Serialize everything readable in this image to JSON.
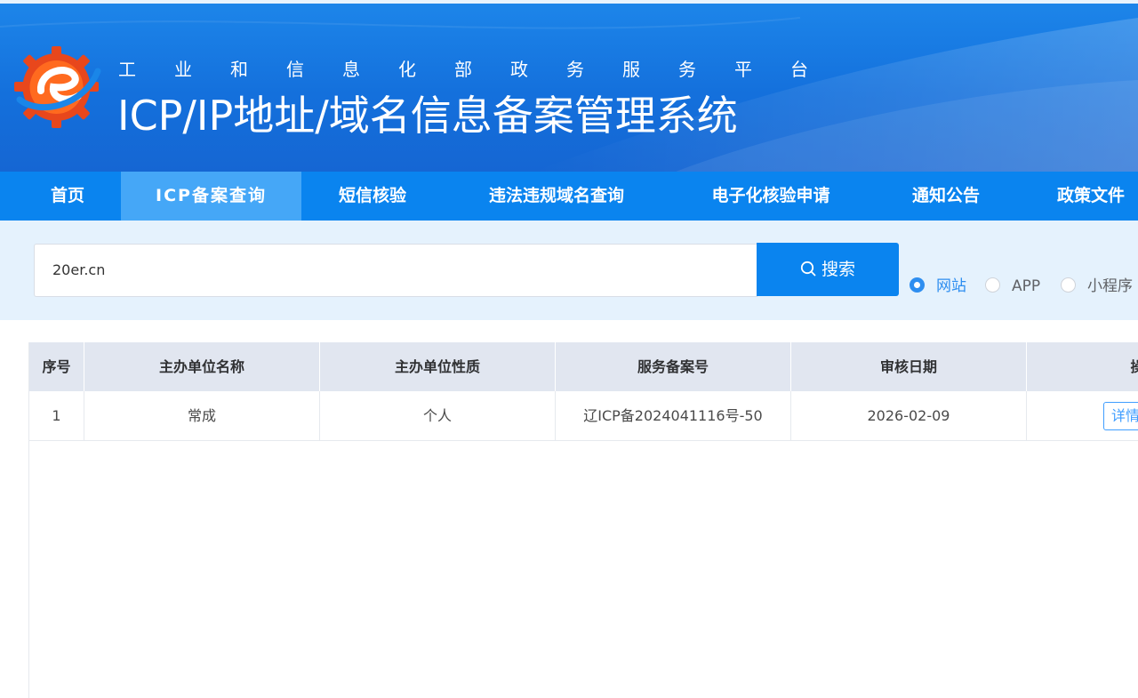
{
  "header": {
    "subtitle": "工业和信息化部政务服务平台",
    "title": "ICP/IP地址/域名信息备案管理系统"
  },
  "nav": {
    "items": [
      "首页",
      "ICP备案查询",
      "短信核验",
      "违法违规域名查询",
      "电子化核验申请",
      "通知公告",
      "政策文件"
    ],
    "active_index": 1
  },
  "search": {
    "value": "20er.cn",
    "button_label": "搜索",
    "types": [
      "网站",
      "APP",
      "小程序"
    ],
    "selected_type": "网站"
  },
  "table": {
    "headers": [
      "序号",
      "主办单位名称",
      "主办单位性质",
      "服务备案号",
      "审核日期",
      "操作"
    ],
    "rows": [
      {
        "index": "1",
        "org_name": "常成",
        "org_type": "个人",
        "license": "辽ICP备2024041116号-50",
        "date": "2026-02-09",
        "action": "详情"
      }
    ]
  },
  "colors": {
    "banner": "#1470dc",
    "nav": "#0a84ef",
    "nav_active": "#45a7f7",
    "search_bg": "#e5f2fd",
    "accent": "#409eff",
    "table_header": "#e1e6f0"
  },
  "icons": [
    "logo-gear-icon",
    "search-icon"
  ]
}
